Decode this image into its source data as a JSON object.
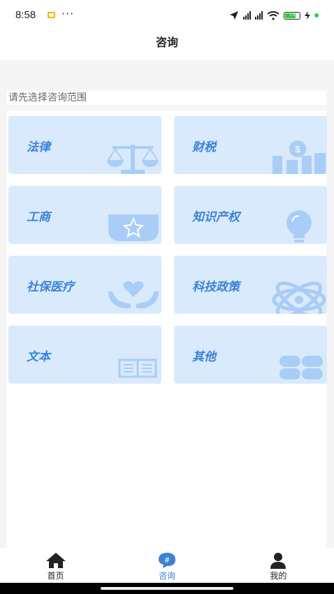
{
  "status": {
    "time": "8:58",
    "dots": "···",
    "battery": "75"
  },
  "header": {
    "title": "咨询"
  },
  "hint": "请先选择咨询范围",
  "categories": [
    {
      "label": "法律",
      "icon": "scale-icon"
    },
    {
      "label": "财税",
      "icon": "money-chart-icon"
    },
    {
      "label": "工商",
      "icon": "star-badge-icon"
    },
    {
      "label": "知识产权",
      "icon": "lightbulb-icon"
    },
    {
      "label": "社保医疗",
      "icon": "hands-heart-icon"
    },
    {
      "label": "科技政策",
      "icon": "atom-icon"
    },
    {
      "label": "文本",
      "icon": "book-icon"
    },
    {
      "label": "其他",
      "icon": "four-pills-icon"
    }
  ],
  "nav": [
    {
      "label": "首页",
      "icon": "home-icon"
    },
    {
      "label": "咨询",
      "icon": "hash-bubble-icon",
      "active": true
    },
    {
      "label": "我的",
      "icon": "user-icon"
    }
  ],
  "colors": {
    "accent": "#3b82d6",
    "card_bg": "#d9eafd",
    "icon_fill": "#a9cdf6"
  }
}
